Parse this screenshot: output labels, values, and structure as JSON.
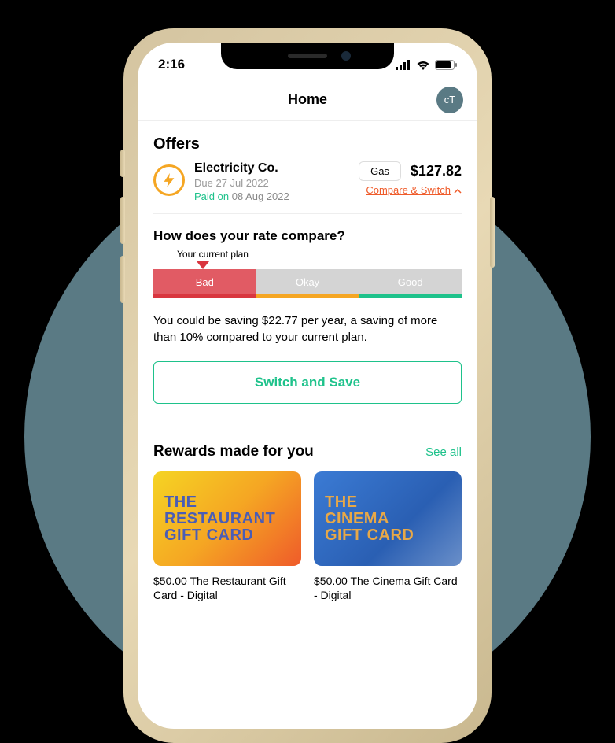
{
  "status": {
    "time": "2:16"
  },
  "header": {
    "title": "Home",
    "avatar": "cT"
  },
  "offers": {
    "title": "Offers",
    "provider": "Electricity Co.",
    "due": "Due 27 Jul 2022",
    "paid_label": "Paid on",
    "paid_date": "08 Aug 2022",
    "chip": "Gas",
    "amount": "$127.82",
    "compare": "Compare & Switch"
  },
  "rate": {
    "title": "How does your rate compare?",
    "current_label": "Your current plan",
    "segments": {
      "bad": "Bad",
      "okay": "Okay",
      "good": "Good"
    },
    "savings": "You could be saving $22.77 per year, a saving of more than 10% compared to your current plan.",
    "button": "Switch and Save"
  },
  "rewards": {
    "title": "Rewards made for you",
    "see_all": "See all",
    "items": [
      {
        "line1": "THE",
        "line2": "RESTAURANT",
        "line3": "GIFT CARD",
        "caption": "$50.00 The Restaurant Gift Card - Digital"
      },
      {
        "line1": "THE",
        "line2": "CINEMA",
        "line3": "GIFT CARD",
        "caption": "$50.00 The Cinema Gift Card - Digital"
      }
    ]
  }
}
